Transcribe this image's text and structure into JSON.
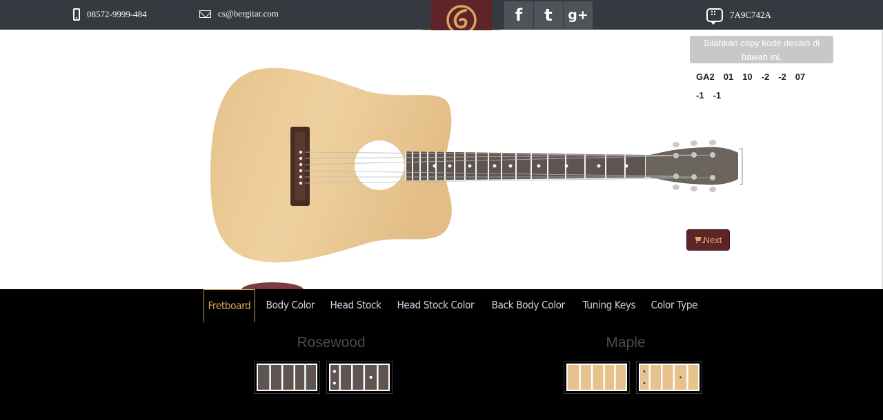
{
  "header": {
    "phone": "08572-9999-484",
    "email": "cs@bergitar.com",
    "bbm_pin": "7A9C742A",
    "social": [
      {
        "icon": "facebook-icon",
        "glyph": "f"
      },
      {
        "icon": "twitter-icon",
        "glyph": "t"
      },
      {
        "icon": "google-plus-icon",
        "glyph": "g+"
      }
    ]
  },
  "design": {
    "hint": "Silahkan copy kode desain di bawah ini.",
    "code_values": [
      "GA2",
      "01",
      "10",
      "-2",
      "-2",
      "07",
      "-1",
      "-1"
    ],
    "next_label": "Next"
  },
  "tabs": [
    {
      "label": "Fretboard",
      "active": true
    },
    {
      "label": "Body Color",
      "active": false
    },
    {
      "label": "Head Stock",
      "active": false
    },
    {
      "label": "Head Stock Color",
      "active": false
    },
    {
      "label": "Back Body Color",
      "active": false
    },
    {
      "label": "Tuning Keys",
      "active": false
    },
    {
      "label": "Color Type",
      "active": false
    }
  ],
  "fretboard_options": {
    "rosewood_title": "Rosewood",
    "maple_title": "Maple"
  },
  "colors": {
    "topbar": "#343a3f",
    "brand": "#5e2428",
    "accent": "#d9a560",
    "rosewood": "#5f5550",
    "maple": "#e7c28d",
    "body_wood": "#ebc994"
  }
}
